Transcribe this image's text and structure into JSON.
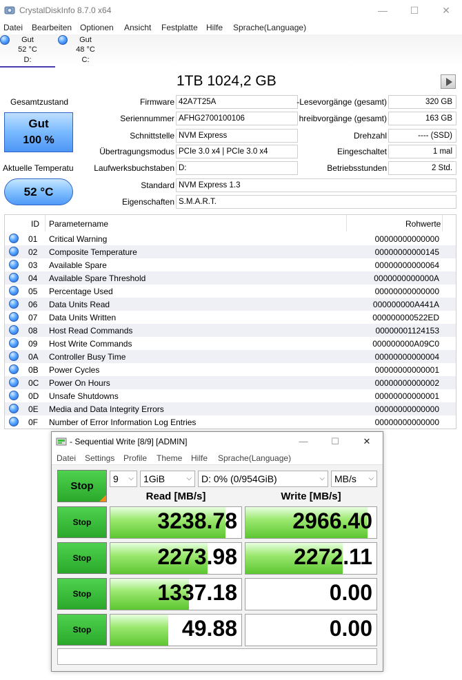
{
  "window": {
    "title": "CrystalDiskInfo 8.7.0 x64"
  },
  "menu": [
    "Datei",
    "Bearbeiten",
    "Optionen",
    "Ansicht",
    "Festplatte",
    "Hilfe",
    "Sprache(Language)"
  ],
  "drives": [
    {
      "status": "Gut",
      "temp": "52 °C",
      "letter": "D:"
    },
    {
      "status": "Gut",
      "temp": "48 °C",
      "letter": "C:"
    }
  ],
  "capacity": "1TB 1024,2 GB",
  "health": {
    "label": "Gesamtzustand",
    "status": "Gut",
    "percent": "100 %"
  },
  "temperature": {
    "label": "Aktuelle Temperatu",
    "value": "52 °C"
  },
  "info": {
    "firmware_label": "Firmware",
    "firmware": "42A7T25A",
    "serial_label": "Seriennummer",
    "serial": "AFHG2700100106",
    "interface_label": "Schnittstelle",
    "interface": "NVM Express",
    "transfer_label": "Übertragungsmodus",
    "transfer": "PCIe 3.0 x4 | PCIe 3.0 x4",
    "letters_label": "Laufwerksbuchstaben",
    "letters": "D:",
    "standard_label": "Standard",
    "standard": "NVM Express 1.3",
    "features_label": "Eigenschaften",
    "features": "S.M.A.R.T.",
    "reads_label": "-Lesevorgänge (gesamt)",
    "reads": "320 GB",
    "writes_label": "hreibvorgänge (gesamt)",
    "writes": "163 GB",
    "rpm_label": "Drehzahl",
    "rpm": "---- (SSD)",
    "power_count_label": "Eingeschaltet",
    "power_count": "1 mal",
    "power_hours_label": "Betriebsstunden",
    "power_hours": "2 Std."
  },
  "smart": {
    "headers": {
      "id": "ID",
      "name": "Parametername",
      "raw": "Rohwerte"
    },
    "rows": [
      {
        "id": "01",
        "name": "Critical Warning",
        "raw": "00000000000000"
      },
      {
        "id": "02",
        "name": "Composite Temperature",
        "raw": "00000000000145"
      },
      {
        "id": "03",
        "name": "Available Spare",
        "raw": "00000000000064"
      },
      {
        "id": "04",
        "name": "Available Spare Threshold",
        "raw": "0000000000000A"
      },
      {
        "id": "05",
        "name": "Percentage Used",
        "raw": "00000000000000"
      },
      {
        "id": "06",
        "name": "Data Units Read",
        "raw": "000000000A441A"
      },
      {
        "id": "07",
        "name": "Data Units Written",
        "raw": "000000000522ED"
      },
      {
        "id": "08",
        "name": "Host Read Commands",
        "raw": "00000001124153"
      },
      {
        "id": "09",
        "name": "Host Write Commands",
        "raw": "000000000A09C0"
      },
      {
        "id": "0A",
        "name": "Controller Busy Time",
        "raw": "00000000000004"
      },
      {
        "id": "0B",
        "name": "Power Cycles",
        "raw": "00000000000001"
      },
      {
        "id": "0C",
        "name": "Power On Hours",
        "raw": "00000000000002"
      },
      {
        "id": "0D",
        "name": "Unsafe Shutdowns",
        "raw": "00000000000001"
      },
      {
        "id": "0E",
        "name": "Media and Data Integrity Errors",
        "raw": "00000000000000"
      },
      {
        "id": "0F",
        "name": "Number of Error Information Log Entries",
        "raw": "00000000000000"
      }
    ]
  },
  "cdm": {
    "title": "- Sequential Write [8/9] [ADMIN]",
    "menu": [
      "Datei",
      "Settings",
      "Profile",
      "Theme",
      "Hilfe",
      "Sprache(Language)"
    ],
    "stop_all": "Stop",
    "count": "9",
    "size": "1GiB",
    "drive": "D: 0% (0/954GiB)",
    "unit": "MB/s",
    "read_header": "Read [MB/s]",
    "write_header": "Write [MB/s]",
    "rows": [
      {
        "stop": "Stop",
        "read": "3238.78",
        "read_fill": 0.88,
        "write": "2966.40",
        "write_fill": 0.93
      },
      {
        "stop": "Stop",
        "read": "2273.98",
        "read_fill": 0.74,
        "write": "2272.11",
        "write_fill": 0.74
      },
      {
        "stop": "Stop",
        "read": "1337.18",
        "read_fill": 0.6,
        "write": "0.00",
        "write_fill": 0
      },
      {
        "stop": "Stop",
        "read": "49.88",
        "read_fill": 0.44,
        "write": "0.00",
        "write_fill": 0
      }
    ],
    "status": ""
  }
}
